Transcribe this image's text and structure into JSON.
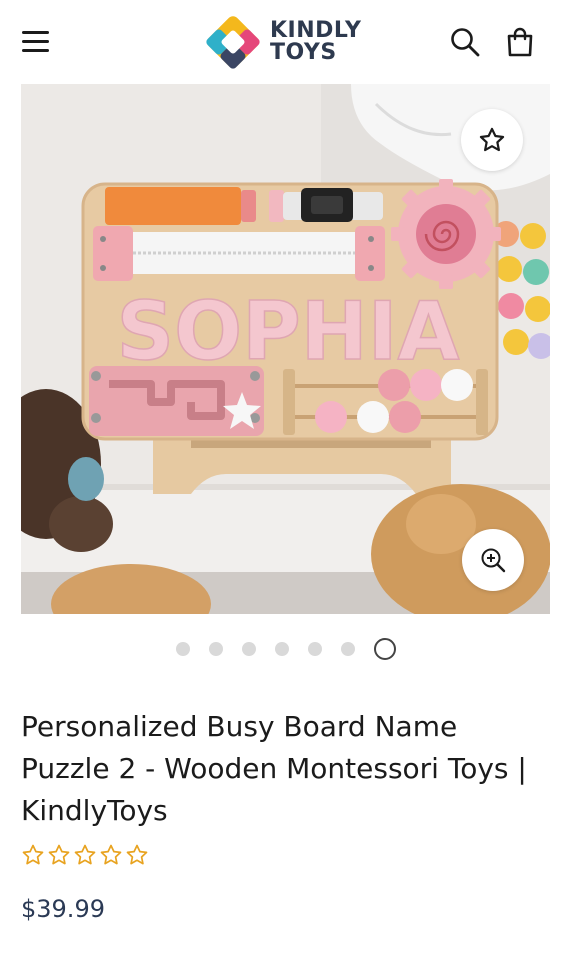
{
  "header": {
    "brand_line1": "KINDLY",
    "brand_line2": "TOYS",
    "icons": [
      "hamburger-menu-icon",
      "search-icon",
      "shopping-bag-icon"
    ]
  },
  "gallery": {
    "board_name_text": "SOPHIA",
    "slide_count": 7,
    "active_slide": 7,
    "icons": [
      "star-outline-icon",
      "zoom-in-icon"
    ]
  },
  "product": {
    "title": "Personalized Busy Board Name Puzzle 2 - Wooden Montessori Toys | KindlyToys",
    "rating_stars": 5,
    "rating_value": 0,
    "price": "$39.99"
  },
  "colors": {
    "brand_dark": "#2e3a4f",
    "star": "#e8a320",
    "price": "#2b3a55"
  }
}
